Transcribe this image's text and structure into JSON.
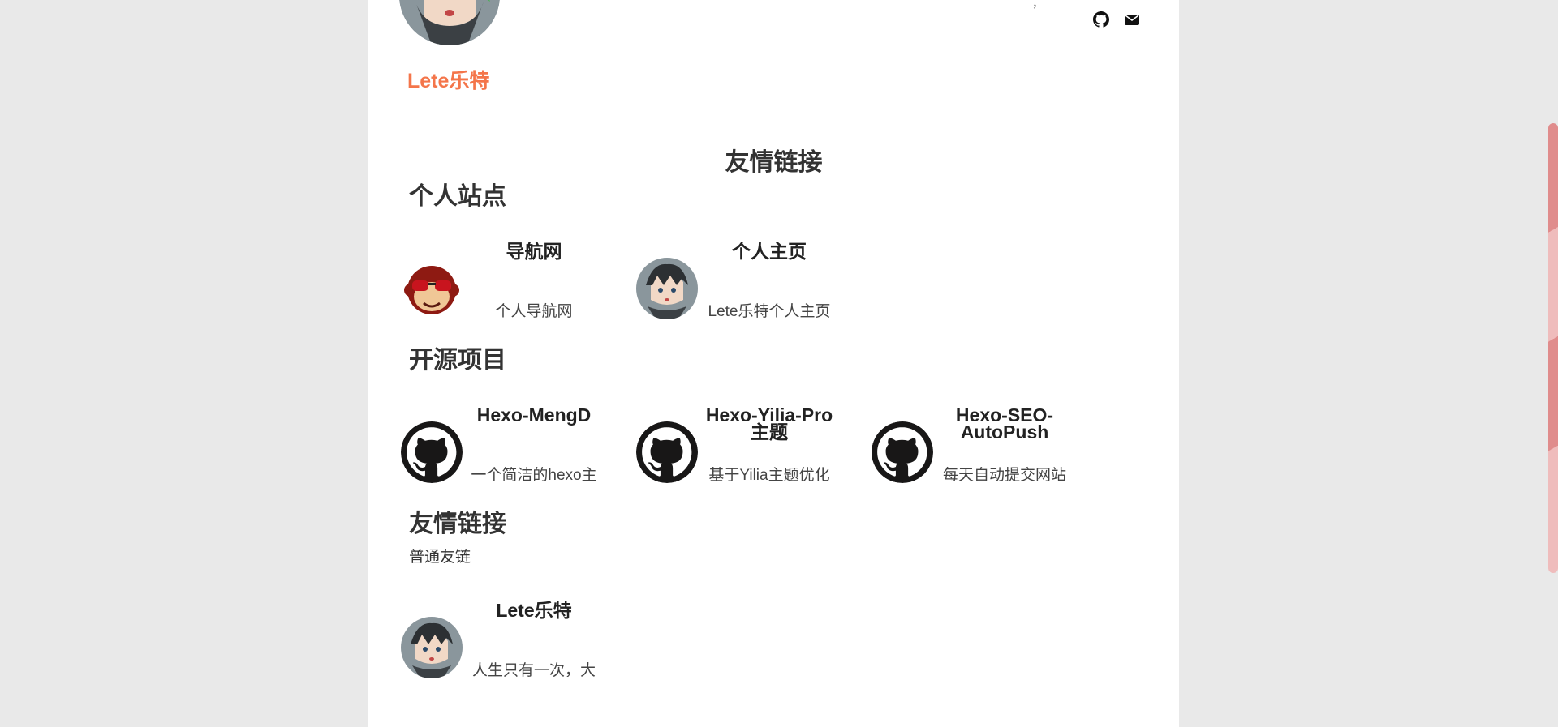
{
  "header": {
    "author_name": "Lete乐特",
    "top_mark": "，",
    "social": [
      {
        "icon": "github-icon"
      },
      {
        "icon": "envelope-icon"
      }
    ]
  },
  "page_title": "友情链接",
  "sections": [
    {
      "title": "个人站点",
      "cards": [
        {
          "name": "导航网",
          "desc": "个人导航网",
          "avatar": "monkey-avatar"
        },
        {
          "name": "个人主页",
          "desc": "Lete乐特个人主页",
          "avatar": "anime-boy-avatar"
        }
      ]
    },
    {
      "title": "开源项目",
      "cards": [
        {
          "name": "Hexo-MengD",
          "desc": "一个简洁的hexo主",
          "avatar": "github-avatar"
        },
        {
          "name": "Hexo-Yilia-Pro主题",
          "desc": "基于Yilia主题优化",
          "avatar": "github-avatar"
        },
        {
          "name": "Hexo-SEO-AutoPush",
          "desc": "每天自动提交网站",
          "avatar": "github-avatar"
        }
      ]
    },
    {
      "title": "友情链接",
      "subtitle": "普通友链",
      "cards": [
        {
          "name": "Lete乐特",
          "desc": "人生只有一次，大",
          "avatar": "anime-boy-avatar"
        }
      ]
    }
  ],
  "colors": {
    "accent": "#f4754a",
    "background": "#e9e9e9",
    "scrollbar": "#e08c8c"
  }
}
